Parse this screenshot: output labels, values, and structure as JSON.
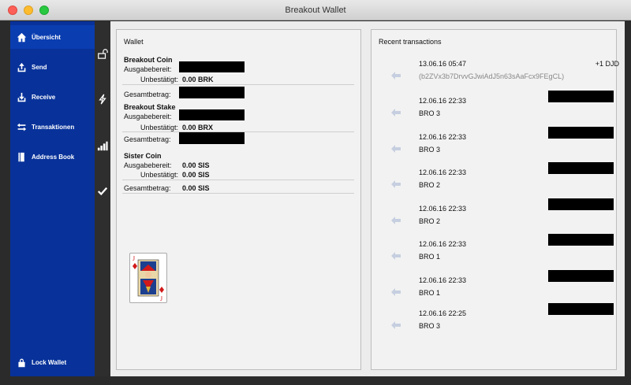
{
  "window": {
    "title": "Breakout Wallet"
  },
  "sidebar": {
    "items": [
      {
        "label": "Übersicht",
        "icon": "home-icon",
        "active": true
      },
      {
        "label": "Send",
        "icon": "send-icon"
      },
      {
        "label": "Receive",
        "icon": "receive-icon"
      },
      {
        "label": "Transaktionen",
        "icon": "transactions-icon"
      },
      {
        "label": "Address Book",
        "icon": "book-icon"
      }
    ],
    "lock": {
      "label": "Lock Wallet",
      "icon": "lock-icon"
    }
  },
  "iconbar": [
    "unlock-icon",
    "stake-bolt-icon",
    "signal-bars-icon",
    "checkmark-icon"
  ],
  "wallet": {
    "title": "Wallet",
    "sections": [
      {
        "name": "Breakout Coin",
        "available_label": "Ausgabebereit:",
        "available_value": "",
        "unconfirmed_label": "Unbestätigt:",
        "unconfirmed_value": "0.00 BRK",
        "total_label": "Gesamtbetrag:",
        "total_value": ""
      },
      {
        "name": "Breakout Stake",
        "available_label": "Ausgabebereit:",
        "available_value": "",
        "unconfirmed_label": "Unbestätigt:",
        "unconfirmed_value": "0.00 BRX",
        "total_label": "Gesamtbetrag:",
        "total_value": ""
      },
      {
        "name": "Sister Coin",
        "available_label": "Ausgabebereit:",
        "available_value": "0.00 SIS",
        "unconfirmed_label": "Unbestätigt:",
        "unconfirmed_value": "0.00 SIS",
        "total_label": "Gesamtbetrag:",
        "total_value": "0.00 SIS"
      }
    ]
  },
  "recent": {
    "title": "Recent transactions",
    "items": [
      {
        "date": "13.06.16 05:47",
        "sub": "(b2ZVx3b7DrvvGJwiAdJ5n63sAaFcx9FEgCL)",
        "amount": "+1 DJD"
      },
      {
        "date": "12.06.16 22:33",
        "sub": "BRO 3"
      },
      {
        "date": "12.06.16 22:33",
        "sub": "BRO 3"
      },
      {
        "date": "12.06.16 22:33",
        "sub": "BRO 2"
      },
      {
        "date": "12.06.16 22:33",
        "sub": "BRO 2"
      },
      {
        "date": "12.06.16 22:33",
        "sub": "BRO 1"
      },
      {
        "date": "12.06.16 22:33",
        "sub": "BRO 1"
      },
      {
        "date": "12.06.16 22:25",
        "sub": "BRO 3"
      }
    ]
  },
  "colors": {
    "sidebar": "#08329a",
    "iconbar": "#2e2e2e",
    "panel": "#f2f2f2"
  }
}
